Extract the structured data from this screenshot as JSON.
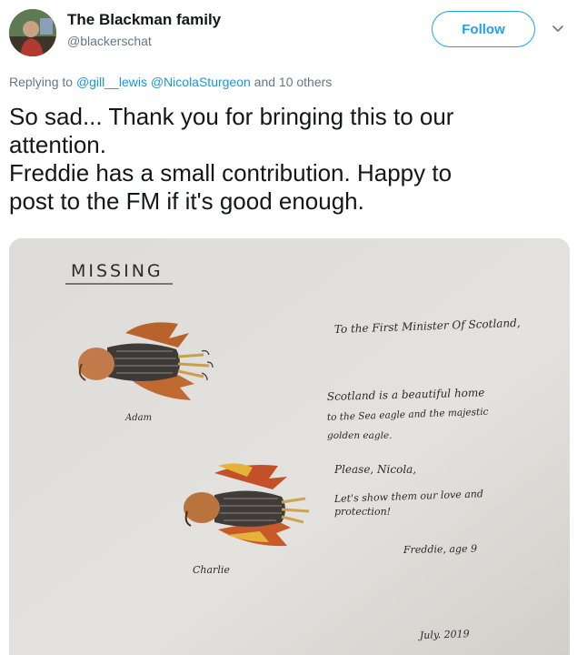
{
  "tweet": {
    "display_name": "The Blackman family",
    "handle": "@blackerschat",
    "follow_label": "Follow",
    "replying_prefix": "Replying to ",
    "replying_mentions": "@gill__lewis @NicolaSturgeon",
    "replying_suffix": " and 10 others",
    "text_lines": [
      "So sad... Thank you for bringing this to our",
      "attention.",
      "Freddie has a small contribution. Happy to",
      "post to the FM if it's good enough."
    ]
  },
  "drawing": {
    "heading": "MISSING",
    "to_line": "To the First Minister Of Scotland,",
    "line1": "Scotland is a beautiful home",
    "line2": "to the Sea eagle and the majestic",
    "line3": "golden eagle.",
    "line4": "Please, Nicola,",
    "line5": "Let's show them our love and",
    "line6": "protection!",
    "signature": "Freddie, age 9",
    "date": "July. 2019",
    "bird1_name": "Adam",
    "bird2_name": "Charlie"
  },
  "icons": {
    "avatar": "user-avatar",
    "caret": "chevron-down-icon"
  },
  "colors": {
    "accent": "#1da1f2",
    "mention": "#1b95e0",
    "secondary_text": "#657786"
  }
}
